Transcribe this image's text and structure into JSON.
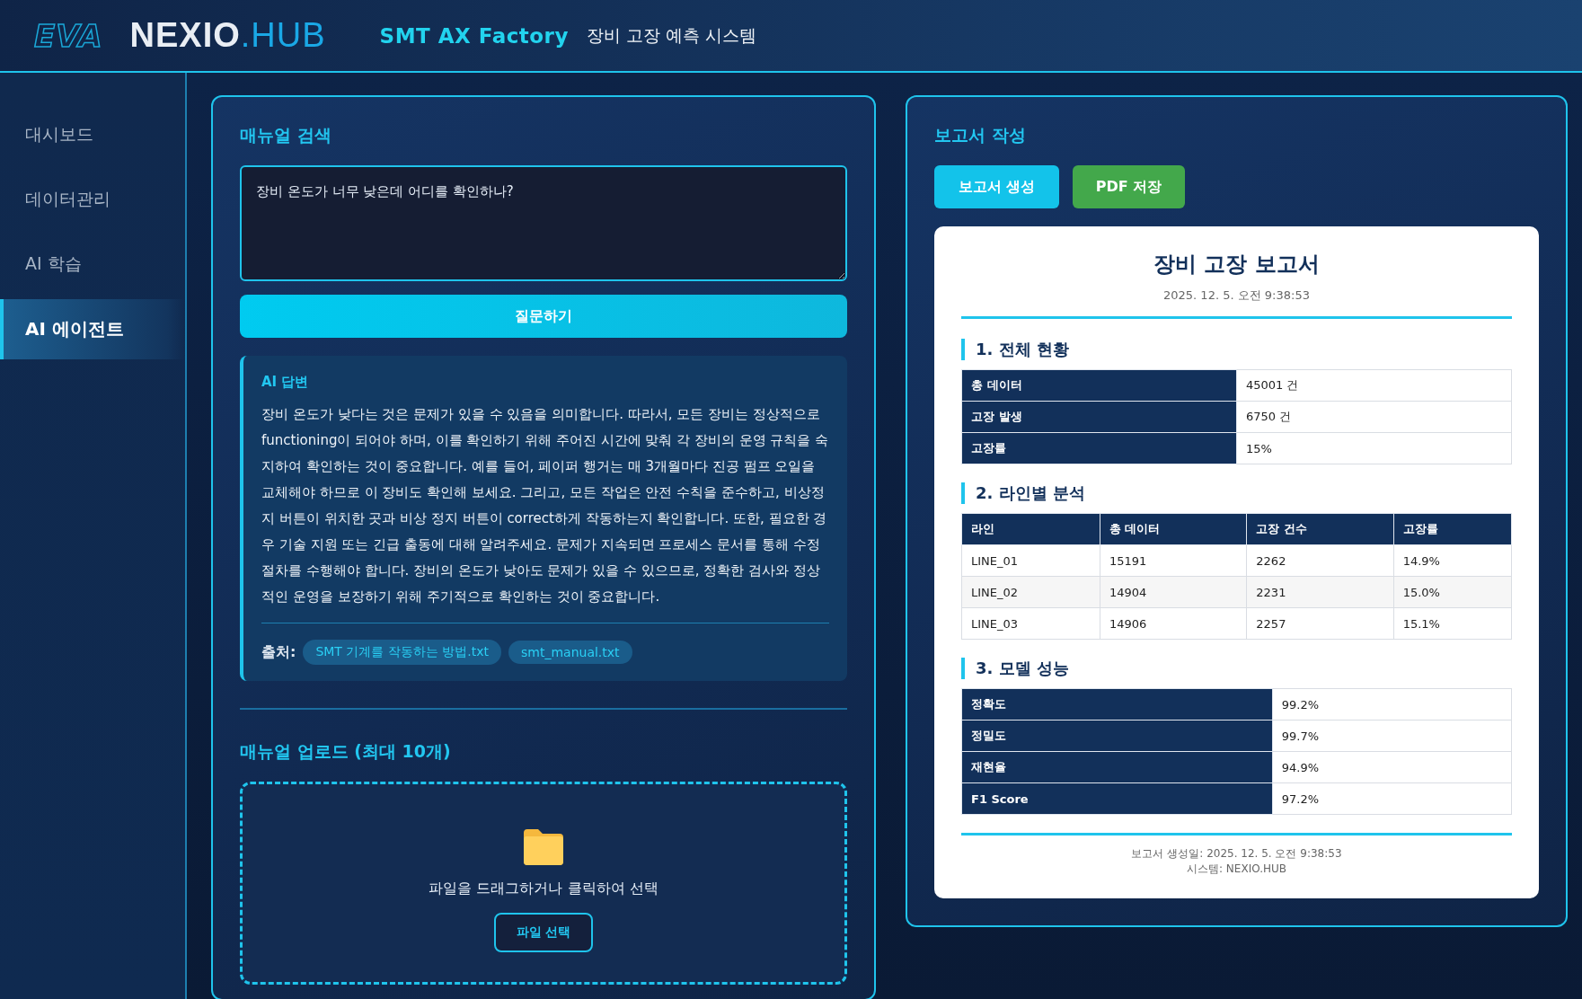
{
  "header": {
    "logo_mark": "EVA",
    "brand": "NEXIO",
    "brand_suffix": ".HUB",
    "app_name": "SMT AX Factory",
    "subtitle": "장비 고장 예측 시스템"
  },
  "sidebar": {
    "items": [
      {
        "label": "대시보드",
        "selected": false
      },
      {
        "label": "데이터관리",
        "selected": false
      },
      {
        "label": "AI 학습",
        "selected": false
      },
      {
        "label": "AI 에이전트",
        "selected": true
      }
    ]
  },
  "manual_search": {
    "title": "매뉴얼 검색",
    "question": "장비 온도가 너무 낮은데 어디를 확인하나?",
    "ask_button": "질문하기",
    "answer": {
      "title": "AI 답변",
      "text": " 장비 온도가 낮다는 것은 문제가 있을 수 있음을 의미합니다. 따라서, 모든 장비는 정상적으로 functioning이 되어야 하며, 이를 확인하기 위해 주어진 시간에 맞춰 각 장비의 운영 규칙을 숙지하여 확인하는 것이 중요합니다. 예를 들어, 페이퍼 행거는 매 3개월마다 진공 펌프 오일을 교체해야 하므로 이 장비도 확인해 보세요. 그리고, 모든 작업은 안전 수칙을 준수하고, 비상정지 버튼이 위치한 곳과 비상 정지 버튼이 correct하게 작동하는지 확인합니다. 또한, 필요한 경우 기술 지원 또는 긴급 출동에 대해 알려주세요. 문제가 지속되면 프로세스 문서를 통해 수정 절차를 수행해야 합니다. 장비의 온도가 낮아도 문제가 있을 수 있으므로, 정확한 검사와 정상적인 운영을 보장하기 위해 주기적으로 확인하는 것이 중요합니다.",
      "sources_label": "출처:",
      "sources": [
        "SMT 기계를 작동하는 방법.txt",
        "smt_manual.txt"
      ]
    }
  },
  "manual_upload": {
    "title": "매뉴얼 업로드 (최대 10개)",
    "drop_text": "파일을 드래그하거나 클릭하여 선택",
    "button": "파일 선택"
  },
  "report_panel": {
    "title": "보고서 작성",
    "buttons": [
      {
        "label": "보고서 생성",
        "kind": "primary"
      },
      {
        "label": "PDF 저장",
        "kind": "success"
      }
    ],
    "report": {
      "title": "장비 고장 보고서",
      "date": "2025. 12. 5. 오전 9:38:53",
      "sections": [
        {
          "kind": "kv",
          "title": "1. 전체 현황",
          "rows": [
            [
              "총 데이터",
              "45001 건"
            ],
            [
              "고장 발생",
              "6750 건"
            ],
            [
              "고장률",
              "15%"
            ]
          ]
        },
        {
          "kind": "table",
          "title": "2. 라인별 분석",
          "columns": [
            "라인",
            "총 데이터",
            "고장 건수",
            "고장률"
          ],
          "rows": [
            [
              "LINE_01",
              "15191",
              "2262",
              "14.9%"
            ],
            [
              "LINE_02",
              "14904",
              "2231",
              "15.0%"
            ],
            [
              "LINE_03",
              "14906",
              "2257",
              "15.1%"
            ]
          ]
        },
        {
          "kind": "kv-wide",
          "title": "3. 모델 성능",
          "rows": [
            [
              "정확도",
              "99.2%"
            ],
            [
              "정밀도",
              "99.7%"
            ],
            [
              "재현율",
              "94.9%"
            ],
            [
              "F1 Score",
              "97.2%"
            ]
          ]
        }
      ],
      "footer": [
        "보고서 생성일: 2025. 12. 5. 오전 9:38:53",
        "시스템: NEXIO.HUB"
      ]
    }
  }
}
